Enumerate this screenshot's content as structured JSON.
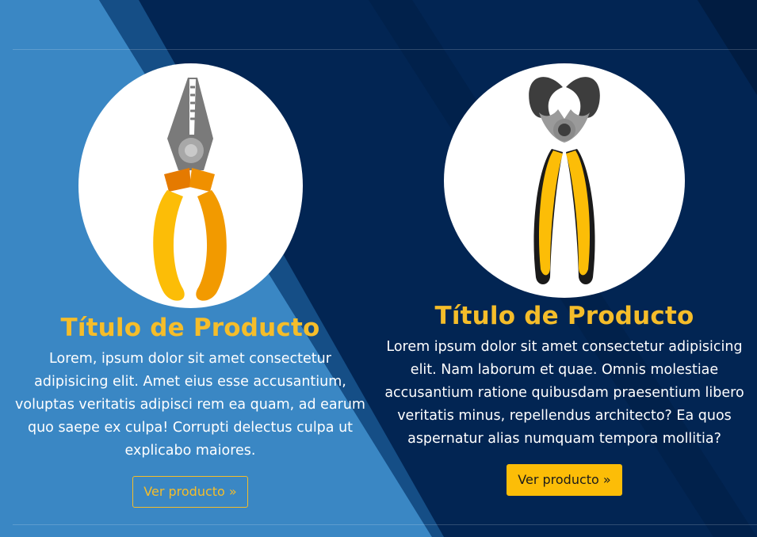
{
  "colors": {
    "accent": "#f5bd2a",
    "button_fill": "#fcbd07",
    "background_dark": "#022553",
    "background_light": "#3a87c4",
    "text": "#ffffff"
  },
  "products": [
    {
      "image_icon": "pliers-icon",
      "title": "Título de Producto",
      "description": "Lorem, ipsum dolor sit amet consectetur adipisicing elit. Amet eius esse accusantium, voluptas veritatis adipisci rem ea quam, ad earum quo saepe ex culpa! Corrupti delectus culpa ut explicabo maiores.",
      "button_label": "Ver producto »"
    },
    {
      "image_icon": "cutting-pliers-icon",
      "title": "Título de Producto",
      "description": "Lorem ipsum dolor sit amet consectetur adipisicing elit. Nam laborum et quae. Omnis molestiae accusantium ratione quibusdam praesentium libero veritatis minus, repellendus architecto? Ea quos aspernatur alias numquam tempora mollitia?",
      "button_label": "Ver producto »"
    }
  ]
}
